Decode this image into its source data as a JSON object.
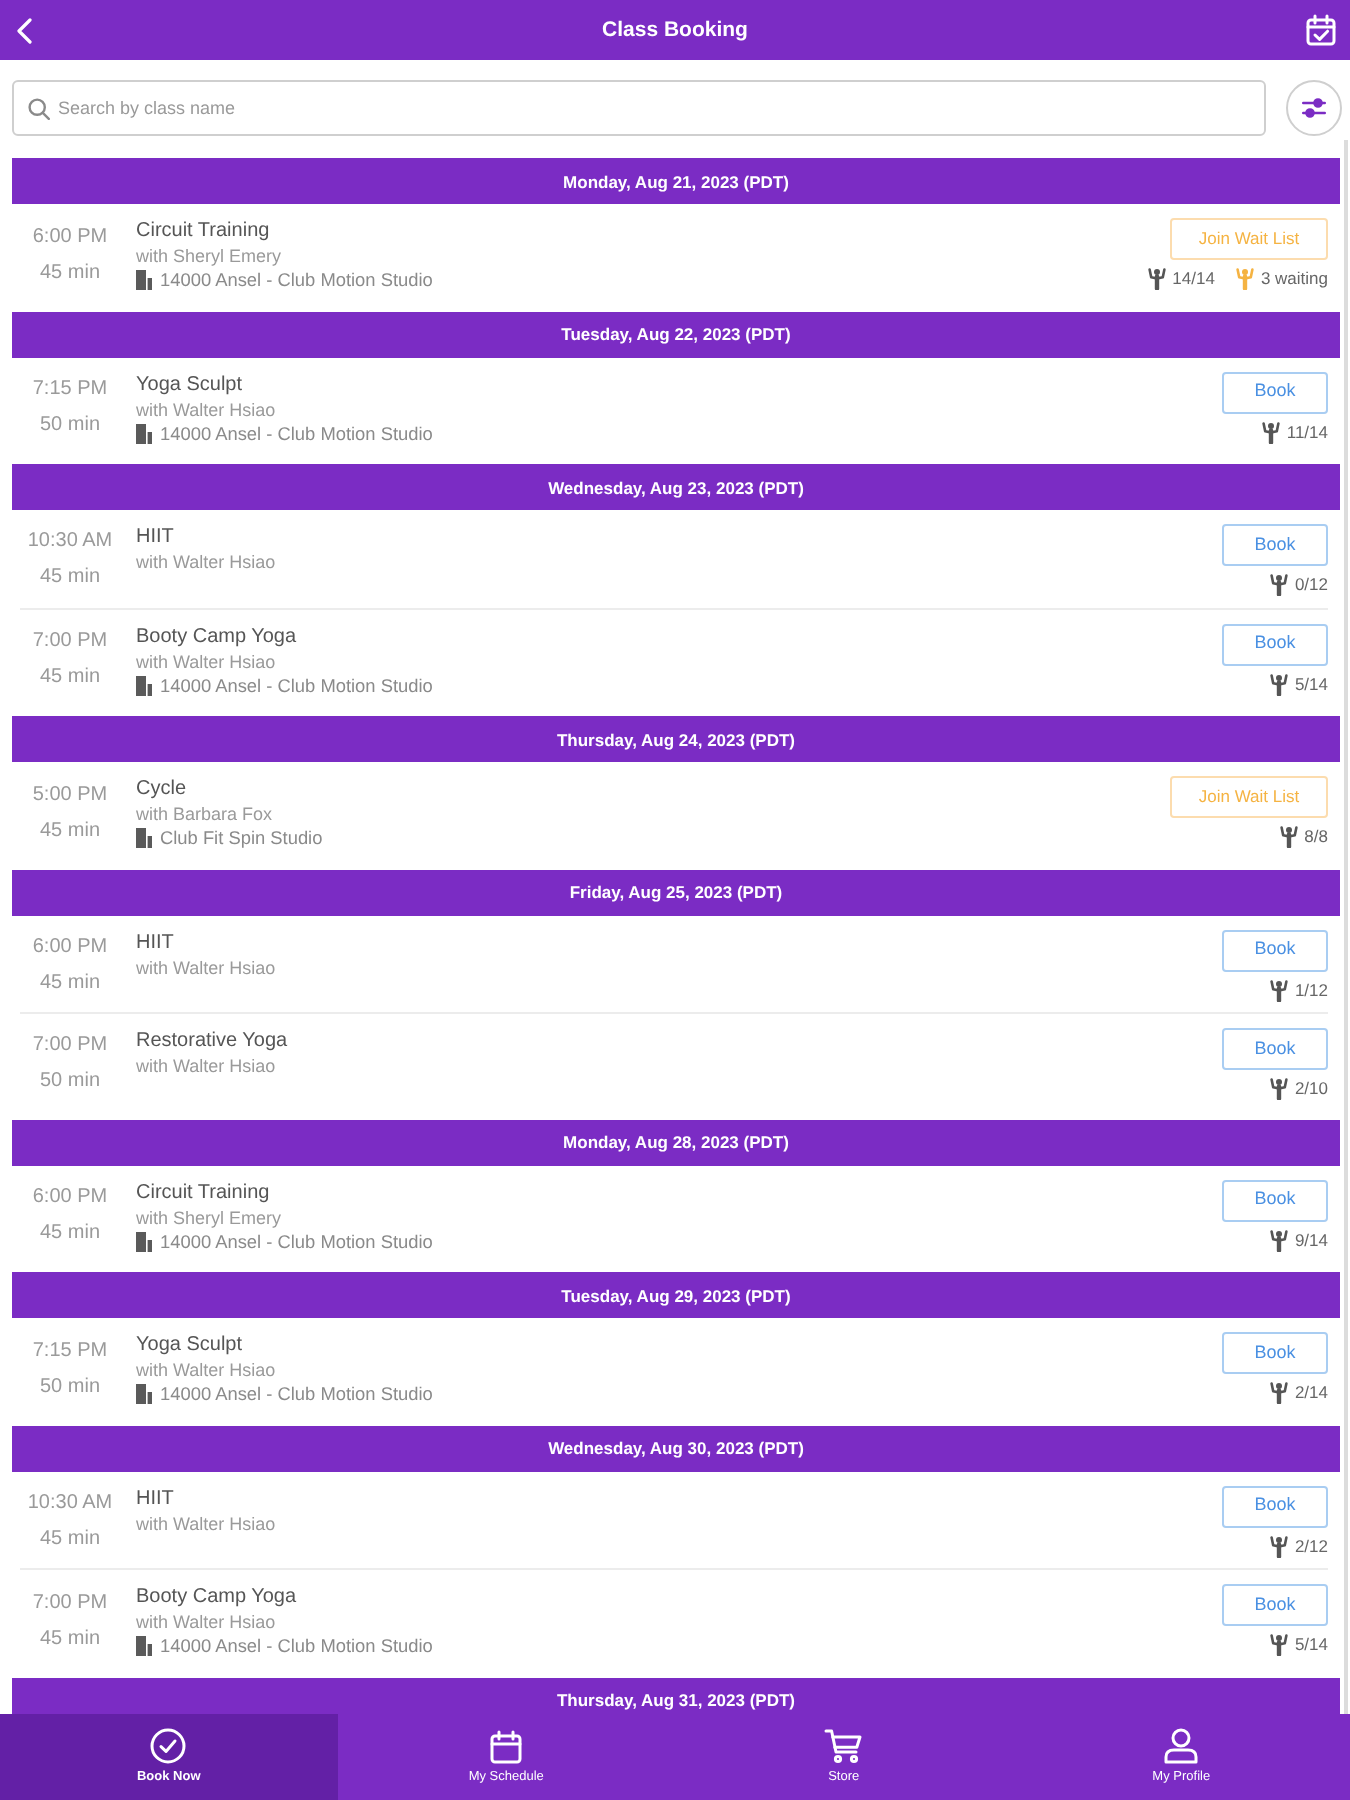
{
  "top_bar": {
    "title": "Class Booking"
  },
  "search": {
    "placeholder": "Search by class name"
  },
  "days": [
    {
      "date": "Monday, Aug 21, 2023 (PDT)",
      "classes": [
        {
          "time": "6:00 PM",
          "duration": "45 min",
          "name": "Circuit Training",
          "instructor": "with Sheryl Emery",
          "location": "14000 Ansel - Club Motion Studio",
          "action": {
            "kind": "waitlist",
            "label": "Join Wait List"
          },
          "capacity": "14/14",
          "waiting": "3 waiting"
        }
      ]
    },
    {
      "date": "Tuesday, Aug 22, 2023 (PDT)",
      "classes": [
        {
          "time": "7:15 PM",
          "duration": "50 min",
          "name": "Yoga Sculpt",
          "instructor": "with Walter Hsiao",
          "location": "14000 Ansel - Club Motion Studio",
          "action": {
            "kind": "book",
            "label": "Book"
          },
          "capacity": "11/14"
        }
      ]
    },
    {
      "date": "Wednesday, Aug 23, 2023 (PDT)",
      "classes": [
        {
          "time": "10:30 AM",
          "duration": "45 min",
          "name": "HIIT",
          "instructor": "with Walter Hsiao",
          "action": {
            "kind": "book",
            "label": "Book"
          },
          "capacity": "0/12"
        },
        {
          "time": "7:00 PM",
          "duration": "45 min",
          "name": "Booty Camp Yoga",
          "instructor": "with Walter Hsiao",
          "location": "14000 Ansel - Club Motion Studio",
          "action": {
            "kind": "book",
            "label": "Book"
          },
          "capacity": "5/14"
        }
      ]
    },
    {
      "date": "Thursday, Aug 24, 2023 (PDT)",
      "classes": [
        {
          "time": "5:00 PM",
          "duration": "45 min",
          "name": "Cycle",
          "instructor": "with Barbara Fox",
          "location": "Club Fit Spin Studio",
          "action": {
            "kind": "waitlist",
            "label": "Join Wait List"
          },
          "capacity": "8/8"
        }
      ]
    },
    {
      "date": "Friday, Aug 25, 2023 (PDT)",
      "classes": [
        {
          "time": "6:00 PM",
          "duration": "45 min",
          "name": "HIIT",
          "instructor": "with Walter Hsiao",
          "action": {
            "kind": "book",
            "label": "Book"
          },
          "capacity": "1/12"
        },
        {
          "time": "7:00 PM",
          "duration": "50 min",
          "name": "Restorative Yoga",
          "instructor": "with Walter Hsiao",
          "action": {
            "kind": "book",
            "label": "Book"
          },
          "capacity": "2/10"
        }
      ]
    },
    {
      "date": "Monday, Aug 28, 2023 (PDT)",
      "classes": [
        {
          "time": "6:00 PM",
          "duration": "45 min",
          "name": "Circuit Training",
          "instructor": "with Sheryl Emery",
          "location": "14000 Ansel - Club Motion Studio",
          "action": {
            "kind": "book",
            "label": "Book"
          },
          "capacity": "9/14"
        }
      ]
    },
    {
      "date": "Tuesday, Aug 29, 2023 (PDT)",
      "classes": [
        {
          "time": "7:15 PM",
          "duration": "50 min",
          "name": "Yoga Sculpt",
          "instructor": "with Walter Hsiao",
          "location": "14000 Ansel - Club Motion Studio",
          "action": {
            "kind": "book",
            "label": "Book"
          },
          "capacity": "2/14"
        }
      ]
    },
    {
      "date": "Wednesday, Aug 30, 2023 (PDT)",
      "classes": [
        {
          "time": "10:30 AM",
          "duration": "45 min",
          "name": "HIIT",
          "instructor": "with Walter Hsiao",
          "action": {
            "kind": "book",
            "label": "Book"
          },
          "capacity": "2/12"
        },
        {
          "time": "7:00 PM",
          "duration": "45 min",
          "name": "Booty Camp Yoga",
          "instructor": "with Walter Hsiao",
          "location": "14000 Ansel - Club Motion Studio",
          "action": {
            "kind": "book",
            "label": "Book"
          },
          "capacity": "5/14"
        }
      ]
    },
    {
      "date": "Thursday, Aug 31, 2023 (PDT)"
    }
  ],
  "nav": {
    "tabs": [
      {
        "label": "Book Now",
        "selected": true
      },
      {
        "label": "My Schedule",
        "selected": false
      },
      {
        "label": "Store",
        "selected": false
      },
      {
        "label": "My Profile",
        "selected": false
      }
    ]
  }
}
